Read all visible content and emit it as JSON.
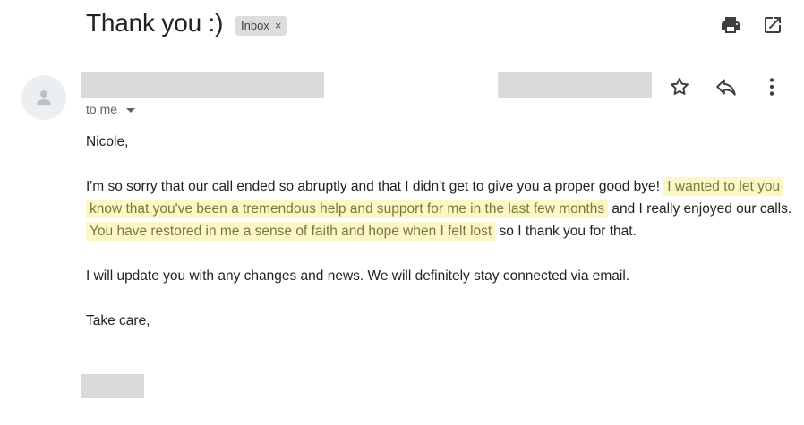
{
  "subject": "Thank you :)",
  "label": {
    "text": "Inbox",
    "remove_glyph": "×"
  },
  "toolbar": {
    "icons": [
      "print-icon",
      "open-in-new-window-icon"
    ]
  },
  "sender": {
    "recipient_line": "to me",
    "actions": [
      "star-icon",
      "reply-icon",
      "more-options-icon"
    ]
  },
  "message": {
    "greeting": "Nicole,",
    "p1": {
      "s1": "I'm so sorry that our call ended so abruptly and that I didn't get to give you a proper good bye!",
      "hl1": "I wanted to let you know that you've been a tremendous help and support for me in the last few months",
      "s2": "and I really enjoyed our calls.",
      "hl2": "You have restored in me a sense of faith and hope when I felt lost",
      "s3": "so I thank you for that."
    },
    "p2": "I will update you with any changes and news.  We will definitely stay connected via email.",
    "closing": "Take care,"
  },
  "colors": {
    "highlight_bg": "#fdf7c8",
    "highlight_text": "#777b3a",
    "redaction": "#d9d9d9",
    "label_chip": "#dddddd"
  }
}
